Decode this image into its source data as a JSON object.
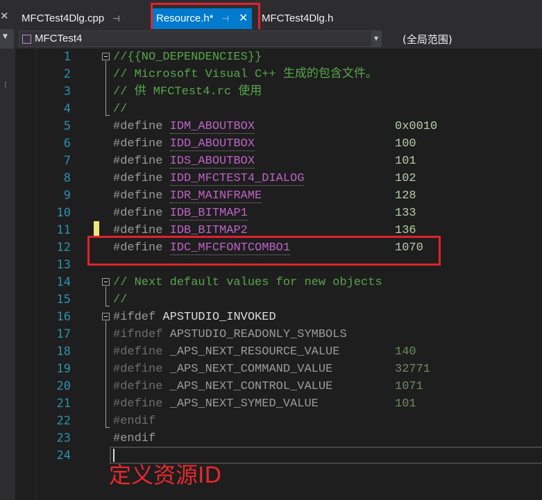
{
  "tabs": [
    {
      "label": "MFCTest4Dlg.cpp",
      "pin": "⊣",
      "active": false
    },
    {
      "label": "Resource.h*",
      "pin": "⊣",
      "close": "✕",
      "active": true
    },
    {
      "label": "MFCTest4Dlg.h",
      "active": false
    }
  ],
  "left_tab_stub": "✕",
  "navbar": {
    "project": "MFCTest4",
    "scope": "(全局范围)"
  },
  "lines": [
    {
      "n": "1",
      "code": "//{{NO_DEPENDENCIES}}"
    },
    {
      "n": "2",
      "code": "// Microsoft Visual C++ 生成的包含文件。"
    },
    {
      "n": "3",
      "code": "// 供 MFCTest4.rc 使用"
    },
    {
      "n": "4",
      "code": "//"
    },
    {
      "n": "5",
      "kw": "#define",
      "id": "IDM_ABOUTBOX",
      "val": "0x0010"
    },
    {
      "n": "6",
      "kw": "#define",
      "id": "IDD_ABOUTBOX",
      "val": "100"
    },
    {
      "n": "7",
      "kw": "#define",
      "id": "IDS_ABOUTBOX",
      "val": "101"
    },
    {
      "n": "8",
      "kw": "#define",
      "id": "IDD_MFCTEST4_DIALOG",
      "val": "102"
    },
    {
      "n": "9",
      "kw": "#define",
      "id": "IDR_MAINFRAME",
      "val": "128"
    },
    {
      "n": "10",
      "kw": "#define",
      "id": "IDB_BITMAP1",
      "val": "133"
    },
    {
      "n": "11",
      "kw": "#define",
      "id": "IDB_BITMAP2",
      "val": "136"
    },
    {
      "n": "12",
      "kw": "#define",
      "id": "IDC_MFCFONTCOMBO1",
      "val": "1070"
    },
    {
      "n": "13",
      "code": ""
    },
    {
      "n": "14",
      "code": "// Next default values for new objects"
    },
    {
      "n": "15",
      "code": "//"
    },
    {
      "n": "16",
      "kw": "#ifdef",
      "id": "APSTUDIO_INVOKED"
    },
    {
      "n": "17",
      "kw": "#ifndef",
      "id": "APSTUDIO_READONLY_SYMBOLS"
    },
    {
      "n": "18",
      "kw": "#define",
      "id": "_APS_NEXT_RESOURCE_VALUE",
      "val": "140"
    },
    {
      "n": "19",
      "kw": "#define",
      "id": "_APS_NEXT_COMMAND_VALUE",
      "val": "32771"
    },
    {
      "n": "20",
      "kw": "#define",
      "id": "_APS_NEXT_CONTROL_VALUE",
      "val": "1071"
    },
    {
      "n": "21",
      "kw": "#define",
      "id": "_APS_NEXT_SYMED_VALUE",
      "val": "101"
    },
    {
      "n": "22",
      "kw": "#endif"
    },
    {
      "n": "23",
      "kw": "#endif"
    },
    {
      "n": "24",
      "code": ""
    }
  ],
  "annotation": "定义资源ID",
  "colors": {
    "accent_tab": "#007acc",
    "highlight_box": "#e0232e",
    "comment": "#57a64a",
    "macro": "#bd63c5",
    "number": "#b5cea8",
    "line_number": "#2b91af"
  }
}
